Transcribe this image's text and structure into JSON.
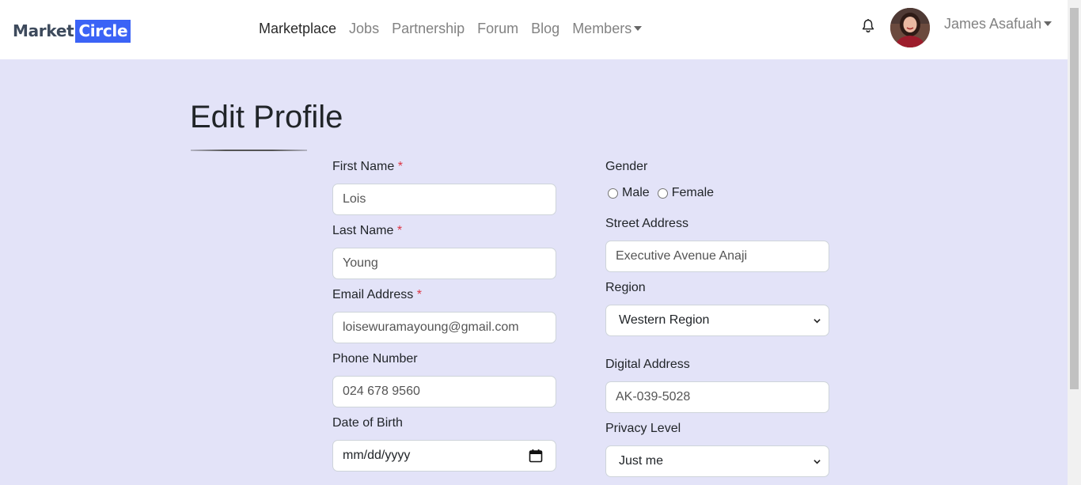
{
  "brand": {
    "word1": "Market",
    "word2": "Circle"
  },
  "nav": {
    "items": [
      "Marketplace",
      "Jobs",
      "Partnership",
      "Forum",
      "Blog",
      "Members"
    ],
    "active": "Marketplace"
  },
  "user": {
    "name": "James Asafuah"
  },
  "page": {
    "title": "Edit Profile"
  },
  "form": {
    "first_name": {
      "label": "First Name",
      "required": "*",
      "value": "Lois"
    },
    "last_name": {
      "label": "Last Name",
      "required": "*",
      "value": "Young"
    },
    "email": {
      "label": "Email Address",
      "required": "*",
      "value": "loisewuramayoung@gmail.com"
    },
    "phone": {
      "label": "Phone Number",
      "value": "024 678 9560"
    },
    "dob": {
      "label": "Date of Birth",
      "placeholder": "mm/dd/yyyy"
    },
    "gender": {
      "label": "Gender",
      "options": [
        "Male",
        "Female"
      ]
    },
    "street": {
      "label": "Street Address",
      "value": "Executive Avenue Anaji"
    },
    "region": {
      "label": "Region",
      "value": "Western Region"
    },
    "digital_address": {
      "label": "Digital Address",
      "value": "AK-039-5028"
    },
    "privacy": {
      "label": "Privacy Level",
      "value": "Just me"
    }
  },
  "colors": {
    "accent": "#3b63f6",
    "background": "#e3e3f8",
    "required": "#dc3545"
  }
}
